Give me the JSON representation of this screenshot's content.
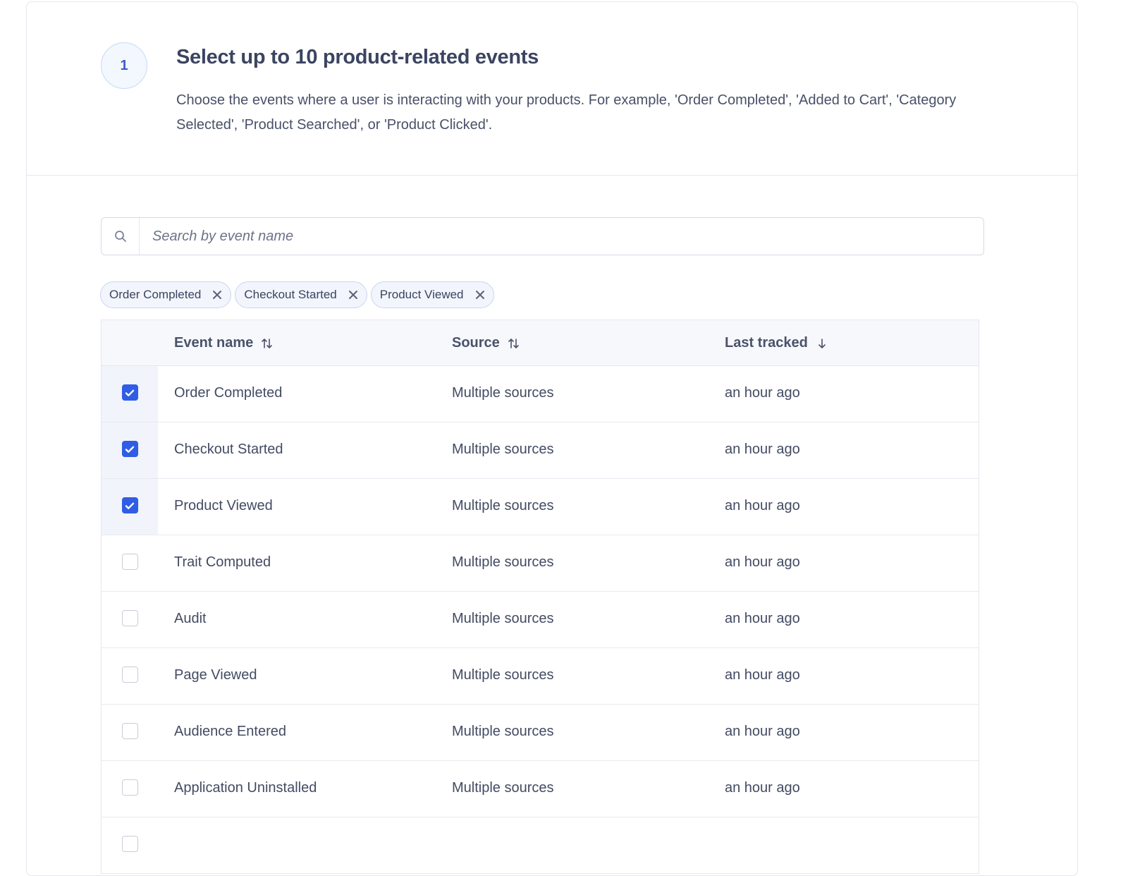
{
  "step": {
    "number": "1",
    "title": "Select up to 10 product-related events",
    "description": "Choose the events where a user is interacting with your products. For example, 'Order Completed', 'Added to Cart', 'Category Selected', 'Product Searched', or 'Product Clicked'."
  },
  "search": {
    "placeholder": "Search by event name",
    "value": "",
    "icon": "search-icon"
  },
  "selected_chips": [
    {
      "label": "Order Completed"
    },
    {
      "label": "Checkout Started"
    },
    {
      "label": "Product Viewed"
    }
  ],
  "table": {
    "columns": [
      {
        "label": "Event name",
        "sort": "sortable"
      },
      {
        "label": "Source",
        "sort": "sortable"
      },
      {
        "label": "Last tracked",
        "sort": "descending"
      }
    ],
    "rows": [
      {
        "checked": true,
        "name": "Order Completed",
        "source": "Multiple sources",
        "last_tracked": "an hour ago"
      },
      {
        "checked": true,
        "name": "Checkout Started",
        "source": "Multiple sources",
        "last_tracked": "an hour ago"
      },
      {
        "checked": true,
        "name": "Product Viewed",
        "source": "Multiple sources",
        "last_tracked": "an hour ago"
      },
      {
        "checked": false,
        "name": "Trait Computed",
        "source": "Multiple sources",
        "last_tracked": "an hour ago"
      },
      {
        "checked": false,
        "name": "Audit",
        "source": "Multiple sources",
        "last_tracked": "an hour ago"
      },
      {
        "checked": false,
        "name": "Page Viewed",
        "source": "Multiple sources",
        "last_tracked": "an hour ago"
      },
      {
        "checked": false,
        "name": "Audience Entered",
        "source": "Multiple sources",
        "last_tracked": "an hour ago"
      },
      {
        "checked": false,
        "name": "Application Uninstalled",
        "source": "Multiple sources",
        "last_tracked": "an hour ago"
      },
      {
        "checked": false,
        "name": "",
        "source": "",
        "last_tracked": ""
      }
    ]
  },
  "colors": {
    "accent": "#2f5de6",
    "text": "#3b4460",
    "border": "#e4e7ee",
    "selected_row_bg": "#f1f4fb"
  }
}
